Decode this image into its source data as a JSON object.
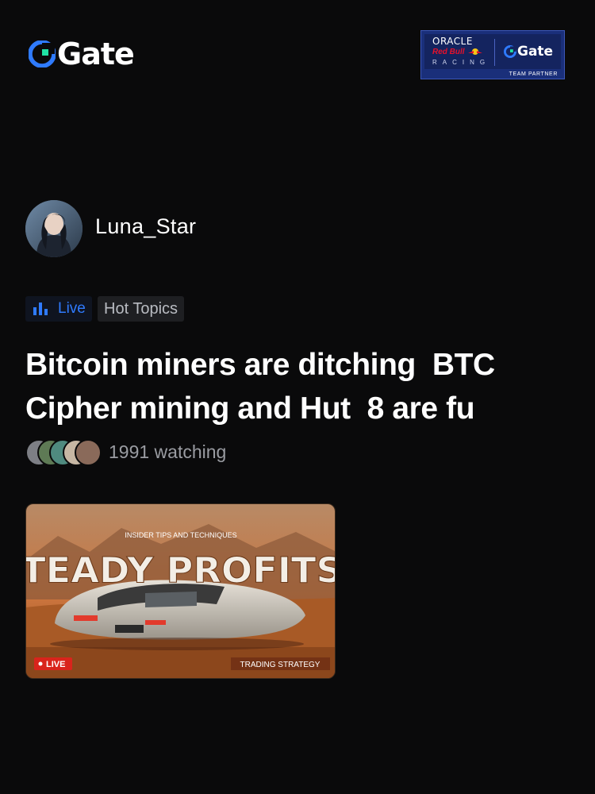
{
  "header": {
    "brand": "Gate",
    "partner": {
      "oracle": "ORACLE",
      "redbull": "Red Bull",
      "racing": "RACING",
      "brand": "Gate",
      "team_partner": "TEAM PARTNER"
    }
  },
  "post": {
    "author": "Luna_Star",
    "tags": {
      "live": "Live",
      "topic": "Hot Topics"
    },
    "title": "Bitcoin miners are ditching  BTC\nCipher mining and Hut  8 are fu",
    "watching": "1991 watching",
    "thumbnail": {
      "kicker": "INSIDER TIPS AND TECHNIQUES",
      "headline": "STEADY PROFITS",
      "live_badge": "LIVE",
      "category": "TRADING STRATEGY"
    }
  },
  "colors": {
    "background": "#0a0a0b",
    "accent_blue": "#2f7bff",
    "live_red": "#d9241c",
    "tag_bg": "#1e1f22"
  },
  "icons": [
    "gate-logo-icon",
    "live-bars-icon",
    "avatar",
    "viewer-avatar"
  ]
}
